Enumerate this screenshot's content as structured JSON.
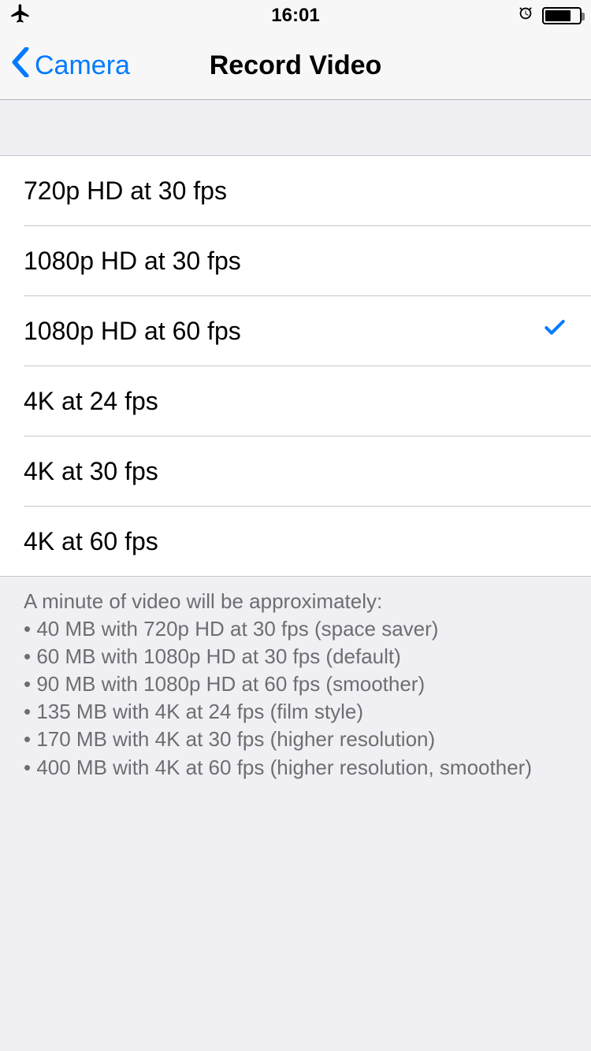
{
  "status": {
    "time": "16:01"
  },
  "nav": {
    "back": "Camera",
    "title": "Record Video"
  },
  "options": [
    {
      "label": "720p HD at 30 fps",
      "selected": false
    },
    {
      "label": "1080p HD at 30 fps",
      "selected": false
    },
    {
      "label": "1080p HD at 60 fps",
      "selected": true
    },
    {
      "label": "4K at 24 fps",
      "selected": false
    },
    {
      "label": "4K at 30 fps",
      "selected": false
    },
    {
      "label": "4K at 60 fps",
      "selected": false
    }
  ],
  "footer": {
    "intro": "A minute of video will be approximately:",
    "lines": [
      "40 MB with 720p HD at 30 fps (space saver)",
      "60 MB with 1080p HD at 30 fps (default)",
      "90 MB with 1080p HD at 60 fps (smoother)",
      "135 MB with 4K at 24 fps (film style)",
      "170 MB with 4K at 30 fps (higher resolution)",
      "400 MB with 4K at 60 fps (higher resolution, smoother)"
    ]
  }
}
